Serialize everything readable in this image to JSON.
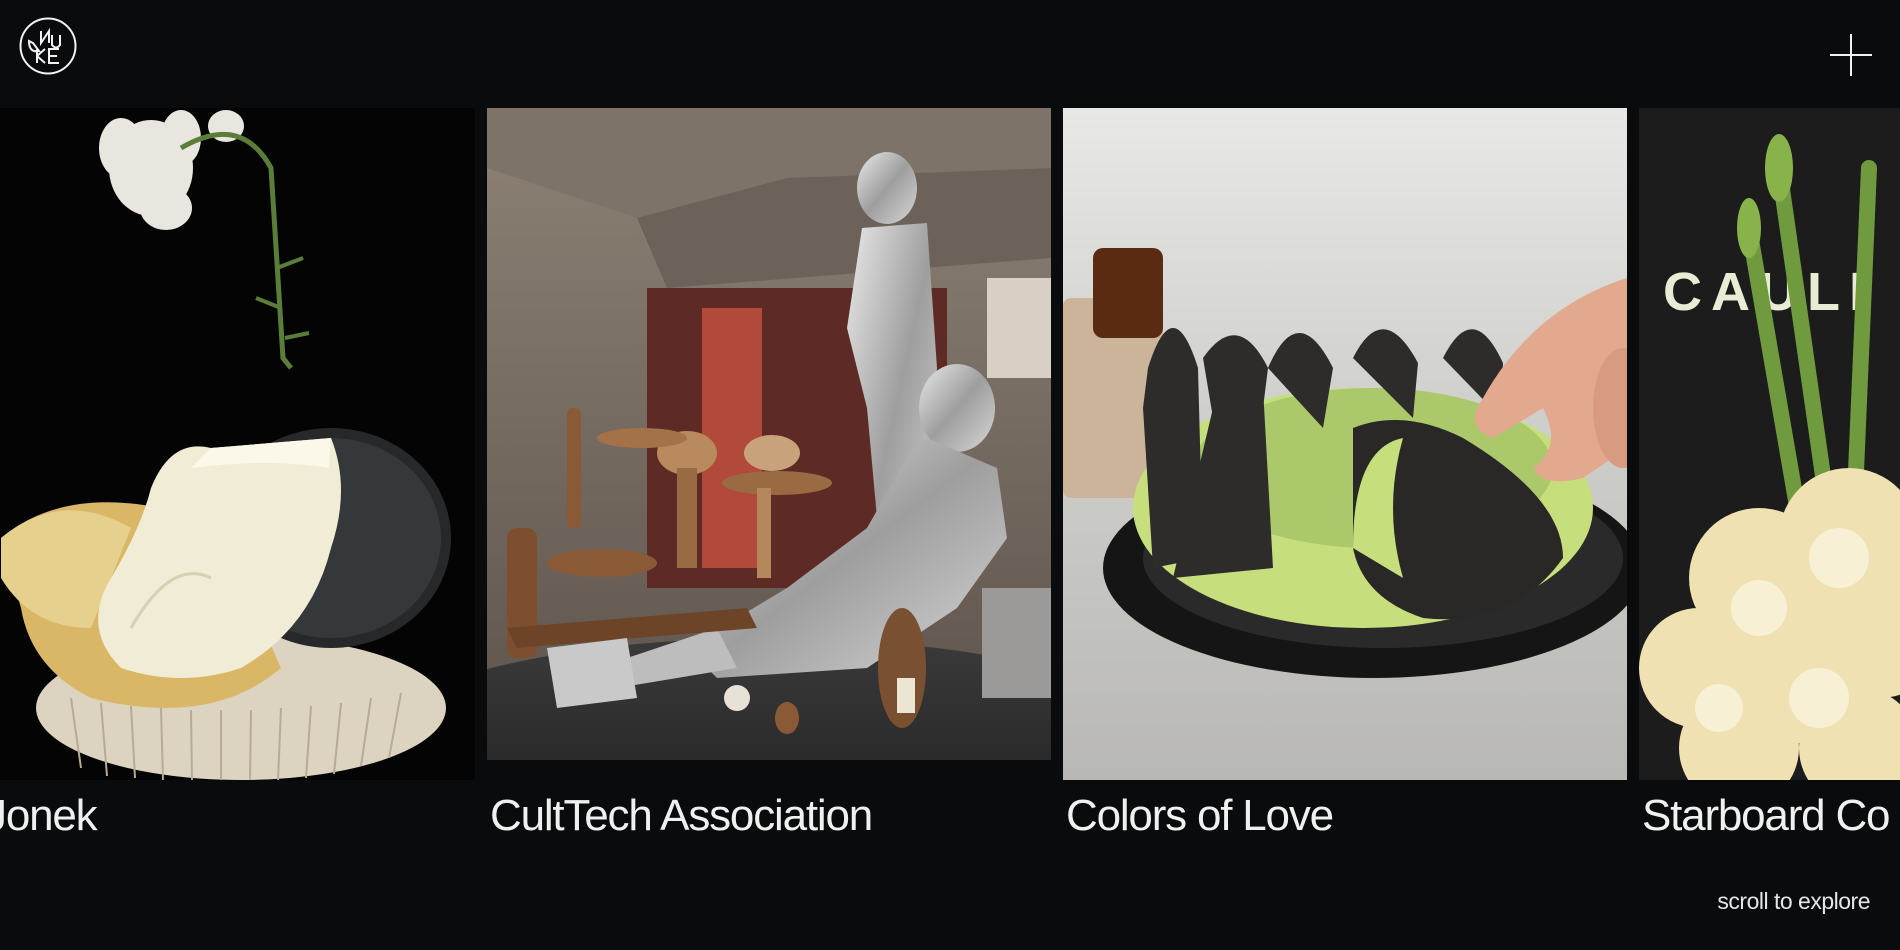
{
  "header": {
    "logo_icon": "onuk-circular-monogram-logo",
    "menu_icon": "plus-icon"
  },
  "projects": [
    {
      "title": "ree Jonek",
      "image": "dessert-meringue-with-feather-flower-on-black"
    },
    {
      "title": "CultTech Association",
      "image": "silver-sculptures-and-bread-installation"
    },
    {
      "title": "Colors of Love",
      "image": "charcoal-croissant-cones-with-green-cream"
    },
    {
      "title": "Starboard Co",
      "image": "cauliflower-and-asparagus-poster",
      "image_text": "CAULI"
    }
  ],
  "footer": {
    "scroll_hint": "scroll to explore"
  },
  "colors": {
    "background": "#0a0b0c",
    "text": "#f2f2f2"
  }
}
